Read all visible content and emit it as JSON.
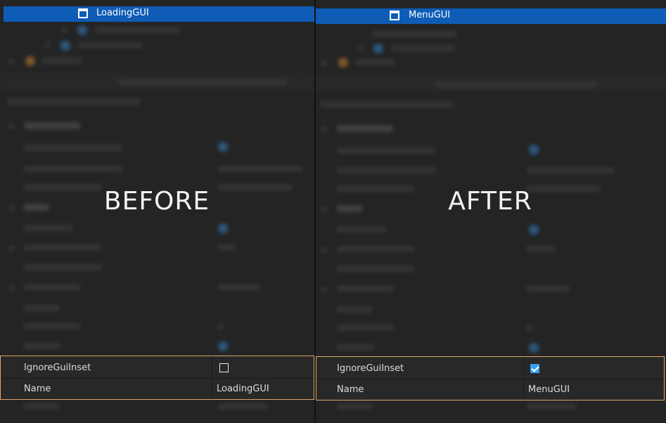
{
  "before": {
    "caption": "BEFORE",
    "selected_item": "LoadingGUI",
    "properties": [
      {
        "name": "IgnoreGuiInset",
        "type": "checkbox",
        "checked": false
      },
      {
        "name": "Name",
        "type": "text",
        "value": "LoadingGUI"
      }
    ]
  },
  "after": {
    "caption": "AFTER",
    "selected_item": "MenuGUI",
    "properties": [
      {
        "name": "IgnoreGuiInset",
        "type": "checkbox",
        "checked": true
      },
      {
        "name": "Name",
        "type": "text",
        "value": "MenuGUI"
      }
    ]
  },
  "colors": {
    "selection": "#0e5cb5",
    "highlight_border": "#e0a76a",
    "checkbox_checked": "#3aa0f0"
  },
  "icons": {
    "selected_item_icon": "screen-gui-icon",
    "checked_icon": "checkmark-icon"
  }
}
